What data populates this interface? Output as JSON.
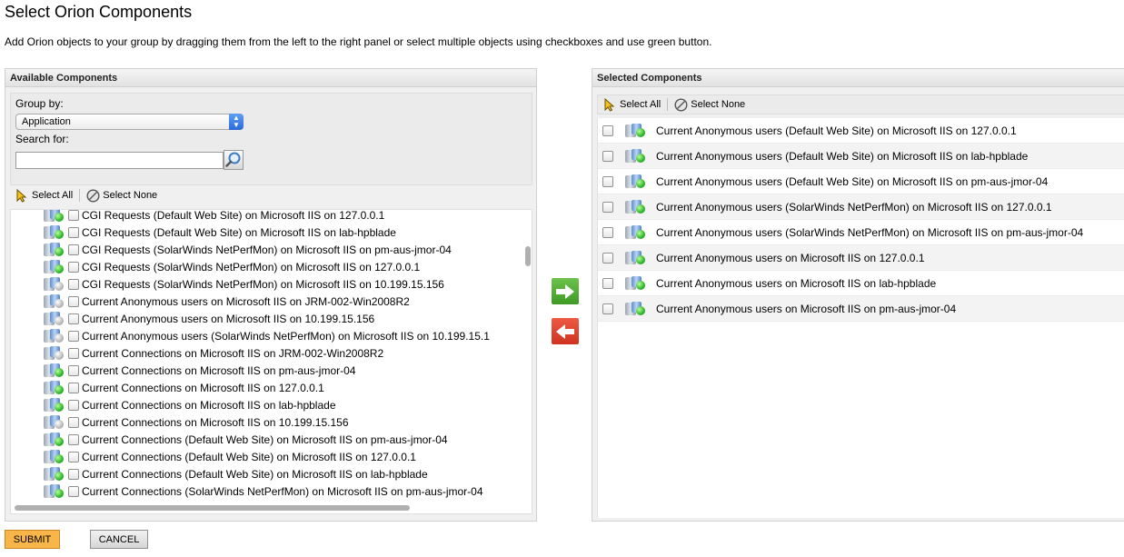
{
  "page": {
    "title": "Select Orion Components",
    "instructions": "Add Orion objects to your group by dragging them from the left to the right panel or select multiple objects using checkboxes and use green button."
  },
  "available": {
    "header": "Available Components",
    "group_by_label": "Group by:",
    "group_by_value": "Application",
    "search_label": "Search for:",
    "search_value": "",
    "select_all": "Select All",
    "select_none": "Select None",
    "items": [
      {
        "label": "CGI Requests (Default Web Site) on Microsoft IIS on 127.0.0.1",
        "status": "up"
      },
      {
        "label": "CGI Requests (Default Web Site) on Microsoft IIS on lab-hpblade",
        "status": "up"
      },
      {
        "label": "CGI Requests (SolarWinds NetPerfMon) on Microsoft IIS on pm-aus-jmor-04",
        "status": "up"
      },
      {
        "label": "CGI Requests (SolarWinds NetPerfMon) on Microsoft IIS on 127.0.0.1",
        "status": "up"
      },
      {
        "label": "CGI Requests (SolarWinds NetPerfMon) on Microsoft IIS on 10.199.15.156",
        "status": "unknown"
      },
      {
        "label": "Current Anonymous users on Microsoft IIS on JRM-002-Win2008R2",
        "status": "unknown"
      },
      {
        "label": "Current Anonymous users on Microsoft IIS on 10.199.15.156",
        "status": "unknown"
      },
      {
        "label": "Current Anonymous users (SolarWinds NetPerfMon) on Microsoft IIS on 10.199.15.1",
        "status": "unknown"
      },
      {
        "label": "Current Connections on Microsoft IIS on JRM-002-Win2008R2",
        "status": "unknown"
      },
      {
        "label": "Current Connections on Microsoft IIS on pm-aus-jmor-04",
        "status": "up"
      },
      {
        "label": "Current Connections on Microsoft IIS on 127.0.0.1",
        "status": "up"
      },
      {
        "label": "Current Connections on Microsoft IIS on lab-hpblade",
        "status": "up"
      },
      {
        "label": "Current Connections on Microsoft IIS on 10.199.15.156",
        "status": "unknown"
      },
      {
        "label": "Current Connections (Default Web Site) on Microsoft IIS on pm-aus-jmor-04",
        "status": "up"
      },
      {
        "label": "Current Connections (Default Web Site) on Microsoft IIS on 127.0.0.1",
        "status": "up"
      },
      {
        "label": "Current Connections (Default Web Site) on Microsoft IIS on lab-hpblade",
        "status": "up"
      },
      {
        "label": "Current Connections (SolarWinds NetPerfMon) on Microsoft IIS on pm-aus-jmor-04",
        "status": "up"
      }
    ]
  },
  "selected": {
    "header": "Selected Components",
    "select_all": "Select All",
    "select_none": "Select None",
    "items": [
      {
        "label": "Current Anonymous users (Default Web Site) on Microsoft IIS on 127.0.0.1",
        "status": "up"
      },
      {
        "label": "Current Anonymous users (Default Web Site) on Microsoft IIS on lab-hpblade",
        "status": "up"
      },
      {
        "label": "Current Anonymous users (Default Web Site) on Microsoft IIS on pm-aus-jmor-04",
        "status": "up"
      },
      {
        "label": "Current Anonymous users (SolarWinds NetPerfMon) on Microsoft IIS on 127.0.0.1",
        "status": "up"
      },
      {
        "label": "Current Anonymous users (SolarWinds NetPerfMon) on Microsoft IIS on pm-aus-jmor-04",
        "status": "up"
      },
      {
        "label": "Current Anonymous users on Microsoft IIS on 127.0.0.1",
        "status": "up"
      },
      {
        "label": "Current Anonymous users on Microsoft IIS on lab-hpblade",
        "status": "up"
      },
      {
        "label": "Current Anonymous users on Microsoft IIS on pm-aus-jmor-04",
        "status": "up"
      }
    ]
  },
  "actions": {
    "submit": "SUBMIT",
    "cancel": "CANCEL"
  },
  "colors": {
    "add_button": "#4caf2f",
    "remove_button": "#e04530",
    "submit_button": "#f8b64a",
    "status_up": "#2fb52b",
    "status_unknown": "#b9b9b9"
  },
  "icons": {
    "select_all": "cursor-arrow-icon",
    "select_none": "no-entry-icon",
    "search": "magnifier-icon",
    "add": "arrow-right-icon",
    "remove": "arrow-left-icon"
  }
}
